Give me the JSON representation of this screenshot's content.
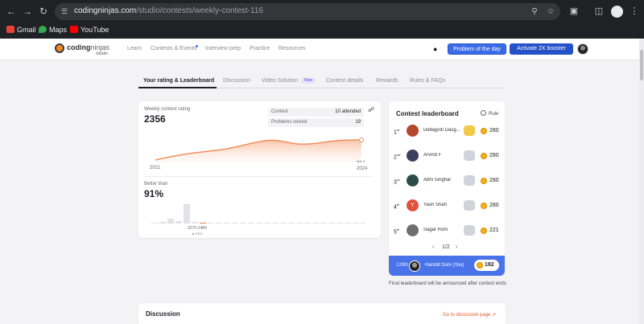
{
  "browser": {
    "url_host": "codingninjas.com",
    "url_path": "/studio/contests/weekly-contest-116",
    "bookmarks": [
      {
        "label": "Gmail",
        "icon": "gmail-icon",
        "color": "#ea4335"
      },
      {
        "label": "Maps",
        "icon": "maps-icon",
        "color": "#34a853"
      },
      {
        "label": "YouTube",
        "icon": "youtube-icon",
        "color": "#ff0000"
      }
    ]
  },
  "header": {
    "logo_main": "coding",
    "logo_accent": "ninjas",
    "logo_sub": "/studio",
    "nav": [
      "Learn",
      "Contests & Events",
      "Interview prep",
      "Practice",
      "Resources"
    ],
    "potd_label": "Problem of the day",
    "boost_label": "Activate 2X booster"
  },
  "tabs": {
    "items": [
      "Your rating & Leaderboard",
      "Discussion",
      "Video Solution",
      "Contest details",
      "Rewards",
      "Rules & FAQs"
    ],
    "new_badge": "New",
    "active": 0
  },
  "rating": {
    "label": "Weekly contest rating",
    "value": "2356",
    "contest_label": "Contest",
    "contest_value": "10 attended",
    "solved_label": "Problems solved",
    "solved_value": "19",
    "x_start": "2021",
    "x_end": "2024",
    "last_point_label": "Mar 5",
    "better_label": "Better than",
    "better_value": "91%",
    "bucket_label": "2270-2484",
    "bucket_count": "7471"
  },
  "leaderboard": {
    "title": "Contest leaderboard",
    "rule_label": "Rule",
    "rows": [
      {
        "rank": "1",
        "suffix": "st",
        "name": "Debajyoti Dasg...",
        "score": "280",
        "avatar_color": "#b4472d",
        "badge_color": "#f2c94c"
      },
      {
        "rank": "2",
        "suffix": "nd",
        "name": "Arvind F",
        "score": "280",
        "avatar_color": "#3b3f5c",
        "badge_color": "#cfd3da"
      },
      {
        "rank": "3",
        "suffix": "rd",
        "name": "Abhi Singhal",
        "score": "280",
        "avatar_color": "#2a4d4a",
        "badge_color": "#cfd3da"
      },
      {
        "rank": "4",
        "suffix": "th",
        "name": "Yash Shah",
        "score": "280",
        "avatar_color": "#e0523a",
        "avatar_letter": "Y",
        "badge_color": "#cfd3da"
      },
      {
        "rank": "5",
        "suffix": "th",
        "name": "Sagar Rohi",
        "score": "221",
        "avatar_color": "#6f6f6f",
        "badge_color": "#cfd3da"
      }
    ],
    "page_label": "1/2",
    "you": {
      "rank": "129th",
      "name": "Harshit Soni (You)",
      "score": "192"
    },
    "final_note": "Final leaderboard will be announced after contest ends"
  },
  "discussion": {
    "title": "Discussion",
    "link": "Go to discussion page"
  },
  "colors": {
    "accent": "#3a6be6",
    "chart_line": "#f0905f",
    "coin": "#f3b11a",
    "highlight": "#e2562b"
  }
}
